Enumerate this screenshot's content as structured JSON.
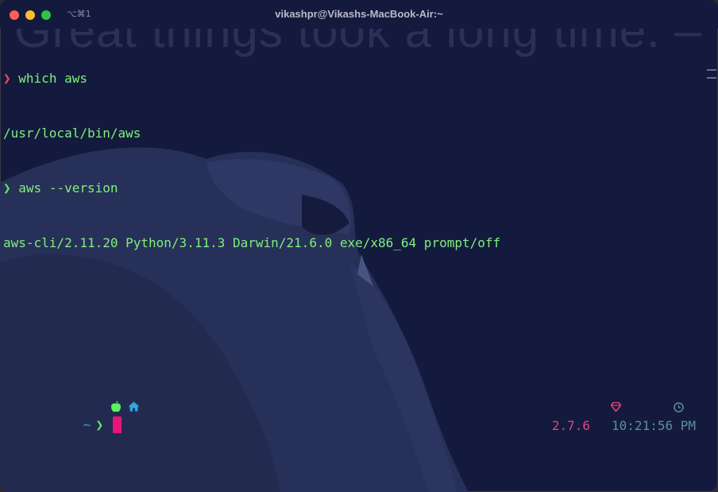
{
  "window": {
    "title": "vikashpr@Vikashs-MacBook-Air:~",
    "shortcut": "⌥⌘1"
  },
  "background": {
    "quote": "Great things took a long time. – S"
  },
  "terminal": {
    "prompt_symbol": "❯",
    "lines": [
      {
        "kind": "command",
        "text": "which aws",
        "prompt_color": "#ff4b56"
      },
      {
        "kind": "output",
        "text": "/usr/local/bin/aws"
      },
      {
        "kind": "command",
        "text": "aws --version",
        "prompt_color": "#5ef05e"
      },
      {
        "kind": "output",
        "text": "aws-cli/2.11.20 Python/3.11.3 Darwin/21.6.0 exe/x86_64 prompt/off"
      }
    ],
    "status": {
      "tilde": "~",
      "arrow": "❯",
      "ruby_version": "2.7.6",
      "time": "10:21:56 PM"
    }
  },
  "colors": {
    "background": "#141a3e",
    "text_green": "#7ef07a",
    "prompt_red": "#ff4b56",
    "cursor_pink": "#e8147a",
    "ruby_pink": "#e0447f",
    "time_teal": "#5c8f92",
    "tilde_blue": "#2fa8e0"
  },
  "icons": {
    "os": "apple-icon",
    "home": "home-icon",
    "ruby": "gem-icon",
    "clock": "clock-icon"
  }
}
